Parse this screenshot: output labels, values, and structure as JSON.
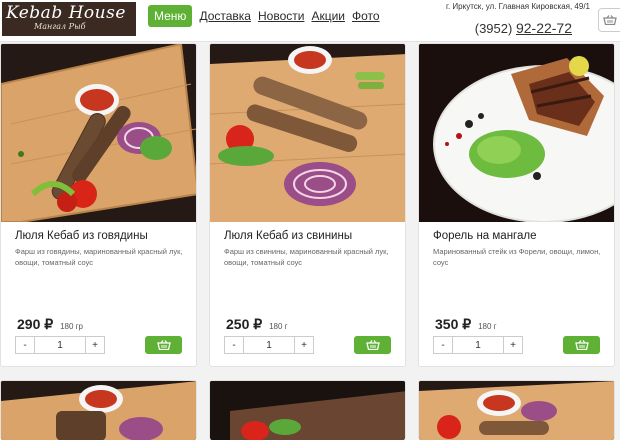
{
  "logo": {
    "title": "Kebab House",
    "subtitle": "Мангал Рыб"
  },
  "nav": {
    "items": [
      {
        "label": "Меню",
        "active": true
      },
      {
        "label": "Доставка",
        "active": false
      },
      {
        "label": "Новости",
        "active": false
      },
      {
        "label": "Акции",
        "active": false
      },
      {
        "label": "Фото",
        "active": false
      }
    ]
  },
  "contact": {
    "address": "г. Иркутск, ул. Главная Кировская, 49/1",
    "phone_code": "(3952)",
    "phone_number": "92-22-72"
  },
  "colors": {
    "accent": "#5fb136",
    "header_bg": "#ffffff",
    "page_bg": "#f2f2f2",
    "logo_bg": "#3a2a22"
  },
  "products": [
    {
      "name": "Люля Кебаб из говядины",
      "description": "Фарш из говядины, маринованный красный лук, овощи, томатный соус",
      "price": "290",
      "currency": "₽",
      "weight": "180 гр",
      "quantity": "1",
      "minus": "-",
      "plus": "+"
    },
    {
      "name": "Люля Кебаб из свинины",
      "description": "Фарш из свинины, маринованный красный лук, овощи, томатный соус",
      "price": "250",
      "currency": "₽",
      "weight": "180 г",
      "quantity": "1",
      "minus": "-",
      "plus": "+"
    },
    {
      "name": "Форель на мангале",
      "description": "Маринованный стейк из Форели, овощи, лимон, соус",
      "price": "350",
      "currency": "₽",
      "weight": "180 г",
      "quantity": "1",
      "minus": "-",
      "plus": "+"
    }
  ]
}
